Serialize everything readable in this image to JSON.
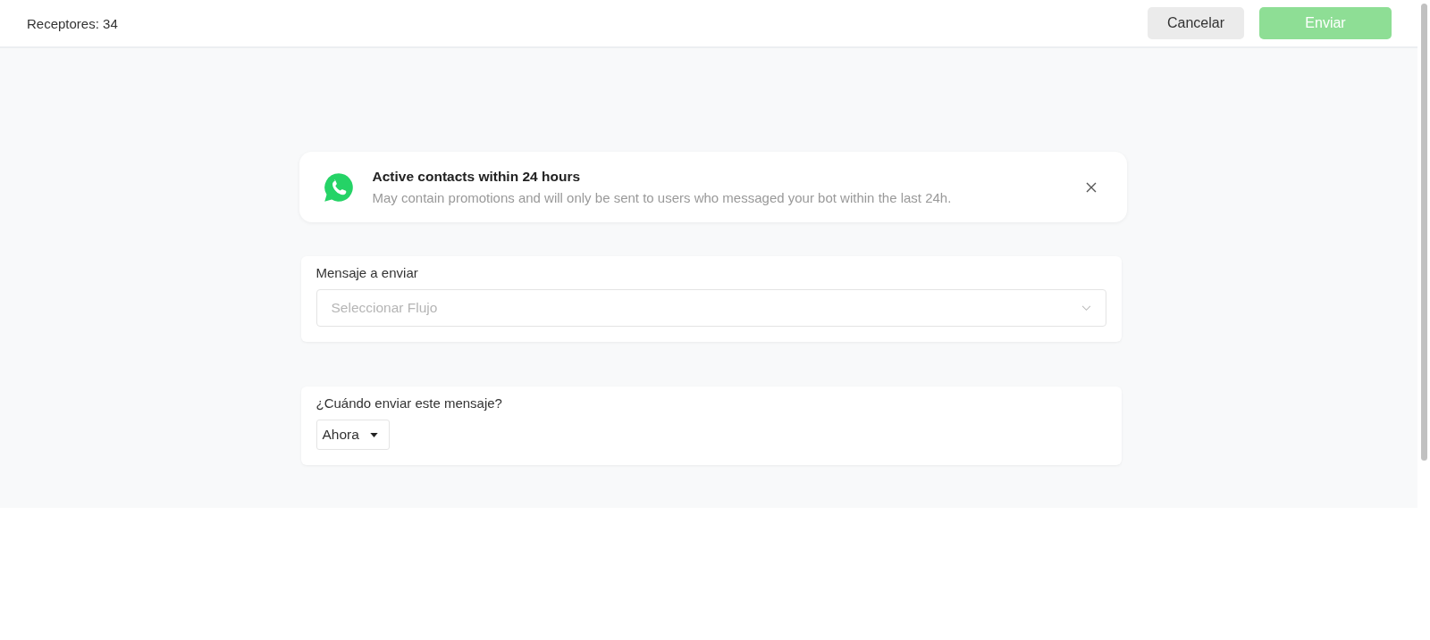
{
  "header": {
    "receivers": "Receptores: 34",
    "buttons": [
      {
        "kind": "secondary",
        "label": "Cancelar",
        "disabled": false
      },
      {
        "kind": "primary",
        "label": "Enviar",
        "disabled": true
      }
    ]
  },
  "banner": {
    "title": "Active contacts within 24 hours",
    "description": "May contain promotions and will only be sent to users who messaged your bot within the last 24h."
  },
  "message_card": {
    "label": "Mensaje a enviar",
    "placeholder": "Seleccionar Flujo"
  },
  "schedule_card": {
    "label": "¿Cuándo enviar este mensaje?",
    "value": "Ahora"
  }
}
